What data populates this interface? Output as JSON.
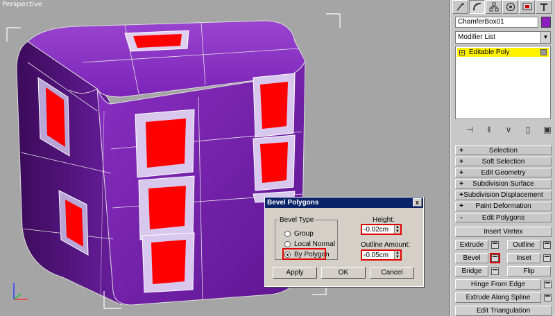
{
  "viewport": {
    "label": "Perspective"
  },
  "command_panel": {
    "tabs": [
      {
        "icon": "create-icon"
      },
      {
        "icon": "modify-icon"
      },
      {
        "icon": "hierarchy-icon"
      },
      {
        "icon": "motion-icon"
      },
      {
        "icon": "display-icon"
      },
      {
        "icon": "utilities-icon"
      }
    ],
    "object_name": "ChamferBox01",
    "object_color": "#8a1fbd",
    "modifier_list": "Modifier List",
    "stack_item": "Editable Poly",
    "stack_sign": "+",
    "rollouts": [
      {
        "sign": "+",
        "label": "Selection"
      },
      {
        "sign": "+",
        "label": "Soft Selection"
      },
      {
        "sign": "+",
        "label": "Edit Geometry"
      },
      {
        "sign": "+",
        "label": "Subdivision Surface"
      },
      {
        "sign": "+",
        "label": "Subdivision Displacement"
      },
      {
        "sign": "+",
        "label": "Paint Deformation"
      },
      {
        "sign": "-",
        "label": "Edit Polygons"
      }
    ],
    "edit_polygons": {
      "insert_vertex": "Insert Vertex",
      "extrude": "Extrude",
      "outline": "Outline",
      "bevel": "Bevel",
      "inset": "Inset",
      "bridge": "Bridge",
      "flip": "Flip",
      "hinge_from_edge": "Hinge From Edge",
      "extrude_along_spline": "Extrude Along Spline",
      "edit_triangulation": "Edit Triangulation"
    }
  },
  "dialog": {
    "title": "Bevel Polygons",
    "close": "x",
    "bevel_type_label": "Bevel Type",
    "options": [
      {
        "label": "Group",
        "selected": false
      },
      {
        "label": "Local Normal",
        "selected": false
      },
      {
        "label": "By Polygon",
        "selected": true
      }
    ],
    "height_label": "Height:",
    "height_value": "-0.02cm",
    "outline_label": "Outline Amount:",
    "outline_value": "-0.05cm",
    "apply": "Apply",
    "ok": "OK",
    "cancel": "Cancel"
  },
  "colors": {
    "accent_highlight": "#e00000",
    "mesh_purple": "#7a1fb0",
    "face_red": "#ff0000",
    "stack_highlight": "#fff200"
  }
}
